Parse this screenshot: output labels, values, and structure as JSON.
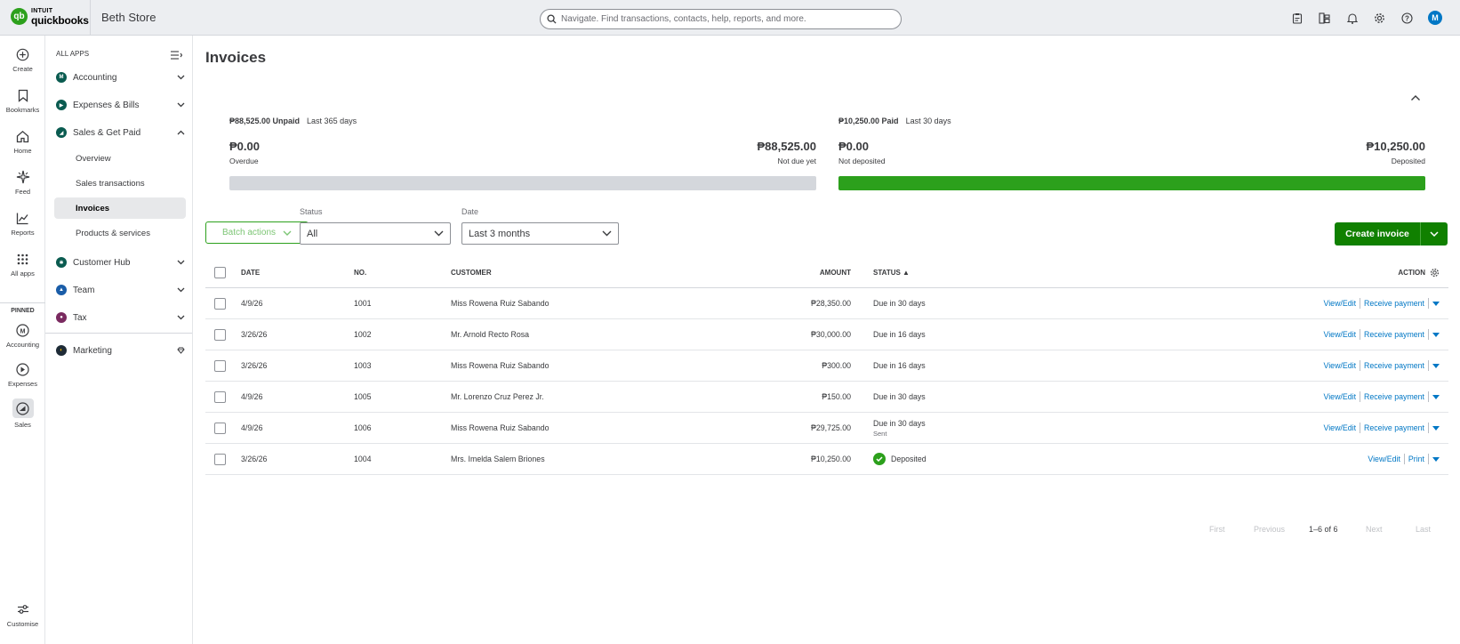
{
  "topbar": {
    "logo_line1": "INTUIT",
    "logo_line2": "quickbooks",
    "logo_mark": "qb",
    "company": "Beth Store",
    "search_placeholder": "Navigate. Find transactions, contacts, help, reports, and more.",
    "avatar_initial": "M",
    "icons": [
      "clipboard-icon",
      "apps-switch-icon",
      "bell-icon",
      "gear-icon",
      "help-icon"
    ]
  },
  "rail": {
    "items": [
      {
        "label": "Create",
        "icon": "plus-circle-icon"
      },
      {
        "label": "Bookmarks",
        "icon": "bookmark-icon"
      },
      {
        "label": "Home",
        "icon": "home-icon"
      },
      {
        "label": "Feed",
        "icon": "sparkle-icon"
      },
      {
        "label": "Reports",
        "icon": "chart-line-icon"
      },
      {
        "label": "All apps",
        "icon": "grid-icon"
      }
    ],
    "pinned_label": "PINNED",
    "pinned": [
      {
        "label": "Accounting",
        "icon": "accounting-icon"
      },
      {
        "label": "Expenses",
        "icon": "expenses-icon"
      },
      {
        "label": "Sales",
        "icon": "sales-icon"
      }
    ],
    "customise_label": "Customise"
  },
  "sidenav": {
    "header": "ALL APPS",
    "items": [
      {
        "label": "Accounting",
        "color": "#0a5b50"
      },
      {
        "label": "Expenses & Bills",
        "color": "#0a5b50"
      },
      {
        "label": "Sales & Get Paid",
        "color": "#0a5b50"
      },
      {
        "label": "Customer Hub",
        "color": "#0a5b50"
      },
      {
        "label": "Team",
        "color": "#1a5da8"
      },
      {
        "label": "Tax",
        "color": "#7a2a60"
      },
      {
        "label": "Marketing",
        "color": "#1e2b36"
      }
    ],
    "sub_items": [
      "Overview",
      "Sales transactions",
      "Invoices",
      "Products & services"
    ]
  },
  "page": {
    "title": "Invoices"
  },
  "summary": {
    "unpaid": {
      "head_amount": "₱88,525.00 Unpaid",
      "head_period": "Last 365 days",
      "left_amount": "₱0.00",
      "left_label": "Overdue",
      "right_amount": "₱88,525.00",
      "right_label": "Not due yet",
      "bar_color": "#d4d7dc"
    },
    "paid": {
      "head_amount": "₱10,250.00 Paid",
      "head_period": "Last 30 days",
      "left_amount": "₱0.00",
      "left_label": "Not deposited",
      "right_amount": "₱10,250.00",
      "right_label": "Deposited",
      "bar_color": "#2ca01c"
    }
  },
  "filters": {
    "batch_label": "Batch actions",
    "status_label": "Status",
    "status_value": "All",
    "date_label": "Date",
    "date_value": "Last 3 months",
    "create_label": "Create invoice"
  },
  "table": {
    "headers": {
      "date": "DATE",
      "no": "NO.",
      "customer": "CUSTOMER",
      "amount": "AMOUNT",
      "status": "STATUS ▲",
      "action": "ACTION"
    },
    "rows": [
      {
        "date": "4/9/26",
        "no": "1001",
        "customer": "Miss Rowena Ruiz Sabando",
        "amount": "₱28,350.00",
        "status": "Due in 30 days",
        "status_sub": "",
        "action1": "View/Edit",
        "action2": "Receive payment"
      },
      {
        "date": "3/26/26",
        "no": "1002",
        "customer": "Mr. Arnold Recto Rosa",
        "amount": "₱30,000.00",
        "status": "Due in 16 days",
        "status_sub": "",
        "action1": "View/Edit",
        "action2": "Receive payment"
      },
      {
        "date": "3/26/26",
        "no": "1003",
        "customer": "Miss Rowena Ruiz Sabando",
        "amount": "₱300.00",
        "status": "Due in 16 days",
        "status_sub": "",
        "action1": "View/Edit",
        "action2": "Receive payment"
      },
      {
        "date": "4/9/26",
        "no": "1005",
        "customer": "Mr. Lorenzo Cruz Perez Jr.",
        "amount": "₱150.00",
        "status": "Due in 30 days",
        "status_sub": "",
        "action1": "View/Edit",
        "action2": "Receive payment"
      },
      {
        "date": "4/9/26",
        "no": "1006",
        "customer": "Miss Rowena Ruiz Sabando",
        "amount": "₱29,725.00",
        "status": "Due in 30 days",
        "status_sub": "Sent",
        "action1": "View/Edit",
        "action2": "Receive payment"
      },
      {
        "date": "3/26/26",
        "no": "1004",
        "customer": "Mrs. Imelda Salem Briones",
        "amount": "₱10,250.00",
        "status": "Deposited",
        "status_sub": "",
        "action1": "View/Edit",
        "action2": "Print"
      }
    ]
  },
  "pager": {
    "first": "First",
    "previous": "Previous",
    "range": "1–6 of 6",
    "next": "Next",
    "last": "Last"
  }
}
